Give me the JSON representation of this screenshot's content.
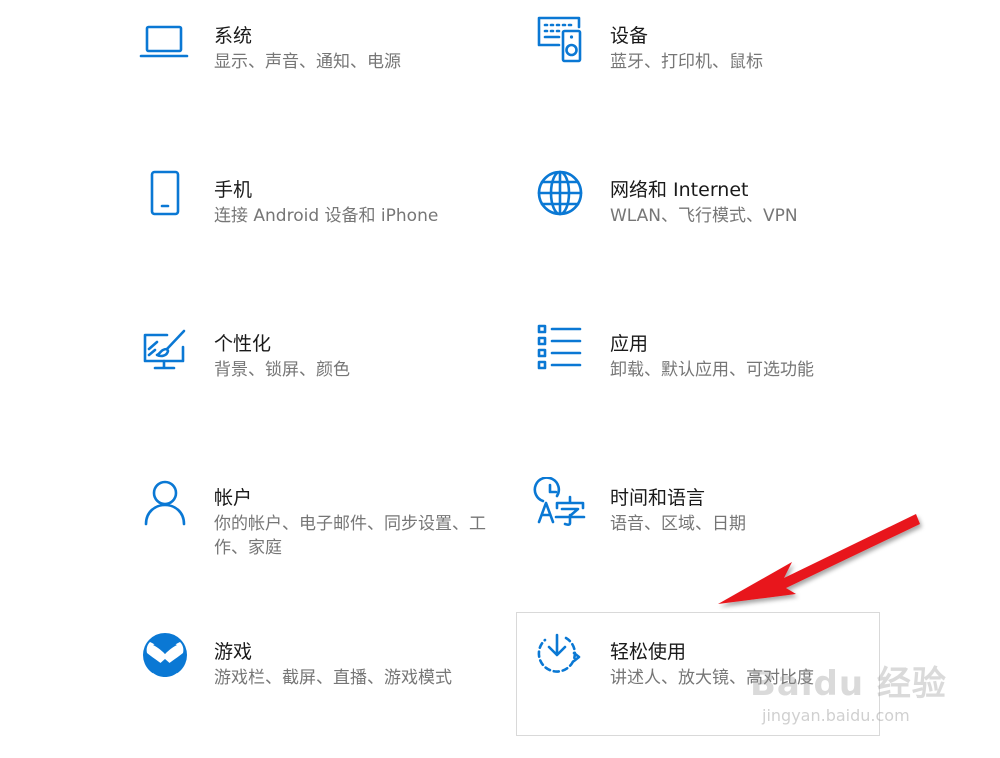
{
  "tiles": [
    {
      "id": "system",
      "title": "系统",
      "desc": "显示、声音、通知、电源"
    },
    {
      "id": "devices",
      "title": "设备",
      "desc": "蓝牙、打印机、鼠标"
    },
    {
      "id": "phone",
      "title": "手机",
      "desc": "连接 Android 设备和 iPhone"
    },
    {
      "id": "network",
      "title": "网络和 Internet",
      "desc": "WLAN、飞行模式、VPN"
    },
    {
      "id": "personalization",
      "title": "个性化",
      "desc": "背景、锁屏、颜色"
    },
    {
      "id": "apps",
      "title": "应用",
      "desc": "卸载、默认应用、可选功能"
    },
    {
      "id": "accounts",
      "title": "帐户",
      "desc": "你的帐户、电子邮件、同步设置、工作、家庭"
    },
    {
      "id": "time-language",
      "title": "时间和语言",
      "desc": "语音、区域、日期"
    },
    {
      "id": "gaming",
      "title": "游戏",
      "desc": "游戏栏、截屏、直播、游戏模式"
    },
    {
      "id": "ease-of-access",
      "title": "轻松使用",
      "desc": "讲述人、放大镜、高对比度"
    }
  ],
  "icons": {
    "system": "laptop-icon",
    "devices": "keyboard-speaker-icon",
    "phone": "phone-icon",
    "network": "globe-icon",
    "personalization": "paint-monitor-icon",
    "apps": "app-list-icon",
    "accounts": "person-icon",
    "time_language": "clock-language-icon",
    "gaming": "xbox-icon",
    "ease_of_access": "ease-of-access-icon"
  },
  "colors": {
    "accent": "#0a78d4",
    "title": "#1a1a1a",
    "description": "#767676",
    "hover_border": "#d9d9d9",
    "annotation_arrow": "#e8141c"
  },
  "watermark": {
    "brand": "Baidu 经验",
    "url": "jingyan.baidu.com"
  }
}
